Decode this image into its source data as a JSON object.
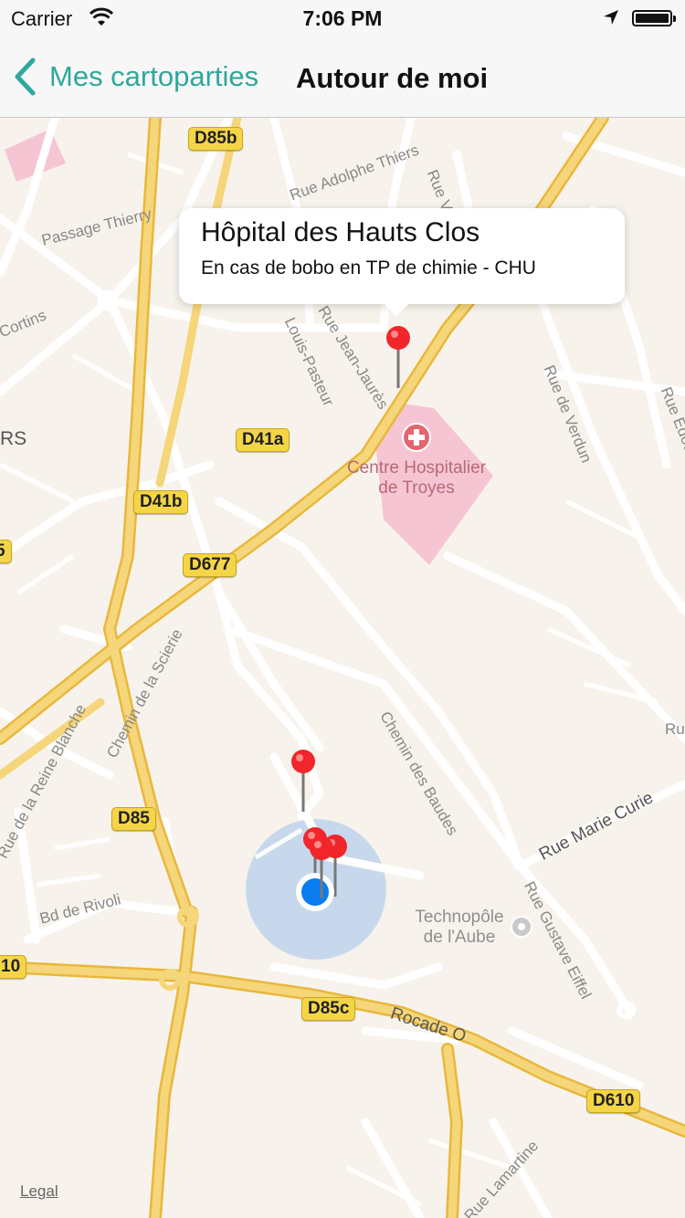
{
  "status_bar": {
    "carrier": "Carrier",
    "time": "7:06 PM"
  },
  "nav": {
    "back_label": "Mes cartoparties",
    "title": "Autour de moi"
  },
  "map": {
    "road_tags": [
      "D85b",
      "D41a",
      "D41b",
      "D677",
      "D85",
      "D85c",
      "D610",
      "10",
      "5"
    ],
    "street_names": [
      "Rue Adolphe Thiers",
      "Passage Thierry",
      "Cortins",
      "Louis-Pasteur",
      "Rue Jean-Jaurès",
      "Rue de Verdun",
      "Rue Edou",
      "Chemin de la Scierie",
      "Chemin des Baudes",
      "Rue Marie Curie",
      "Rue Gustave Eiffel",
      "Bd de Rivoli",
      "Rue de la Reine Blanche",
      "Rocade O",
      "Rue Lamartine",
      "Rue Vale",
      "RS",
      "Ru"
    ],
    "poi_hospital": {
      "line1": "Centre Hospitalier",
      "line2": "de Troyes"
    },
    "poi_techno": {
      "line1": "Technopôle",
      "line2": "de l'Aube"
    },
    "legal": "Legal",
    "callout": {
      "title": "Hôpital des Hauts Clos",
      "subtitle": "En cas de bobo en TP de chimie - CHU"
    }
  },
  "colors": {
    "accent": "#2ea89c",
    "pin": "#f0262a",
    "user_location": "#0a7cf0",
    "hospital_area": "#f6c5d4",
    "major_road": "#f6c84d"
  }
}
